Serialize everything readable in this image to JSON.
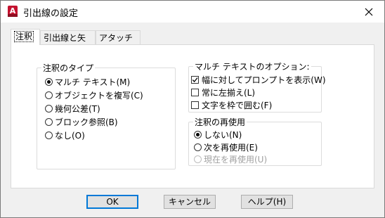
{
  "window": {
    "title": "引出線の設定",
    "app_icon_letter": "A"
  },
  "tabs": [
    {
      "label": "注釈",
      "active": true
    },
    {
      "label": "引出線と矢印",
      "active": false
    },
    {
      "label": "アタッチ位置",
      "active": false
    }
  ],
  "annotation_type": {
    "legend": "注釈のタイプ",
    "options": [
      {
        "label": "マルチ テキスト(M)",
        "selected": true
      },
      {
        "label": "オブジェクトを複写(C)",
        "selected": false
      },
      {
        "label": "幾何公差(T)",
        "selected": false
      },
      {
        "label": "ブロック参照(B)",
        "selected": false
      },
      {
        "label": "なし(O)",
        "selected": false
      }
    ]
  },
  "mtext_options": {
    "legend": "マルチ テキストのオプション:",
    "items": [
      {
        "label": "幅に対してプロンプトを表示(W)",
        "checked": true
      },
      {
        "label": "常に左揃え(L)",
        "checked": false
      },
      {
        "label": "文字を枠で囲む(F)",
        "checked": false
      }
    ]
  },
  "annotation_reuse": {
    "legend": "注釈の再使用",
    "options": [
      {
        "label": "しない(N)",
        "selected": true,
        "enabled": true
      },
      {
        "label": "次を再使用(E)",
        "selected": false,
        "enabled": true
      },
      {
        "label": "現在を再使用(U)",
        "selected": false,
        "enabled": false
      }
    ]
  },
  "buttons": {
    "ok": "OK",
    "cancel": "キャンセル",
    "help": "ヘルプ(H)"
  }
}
